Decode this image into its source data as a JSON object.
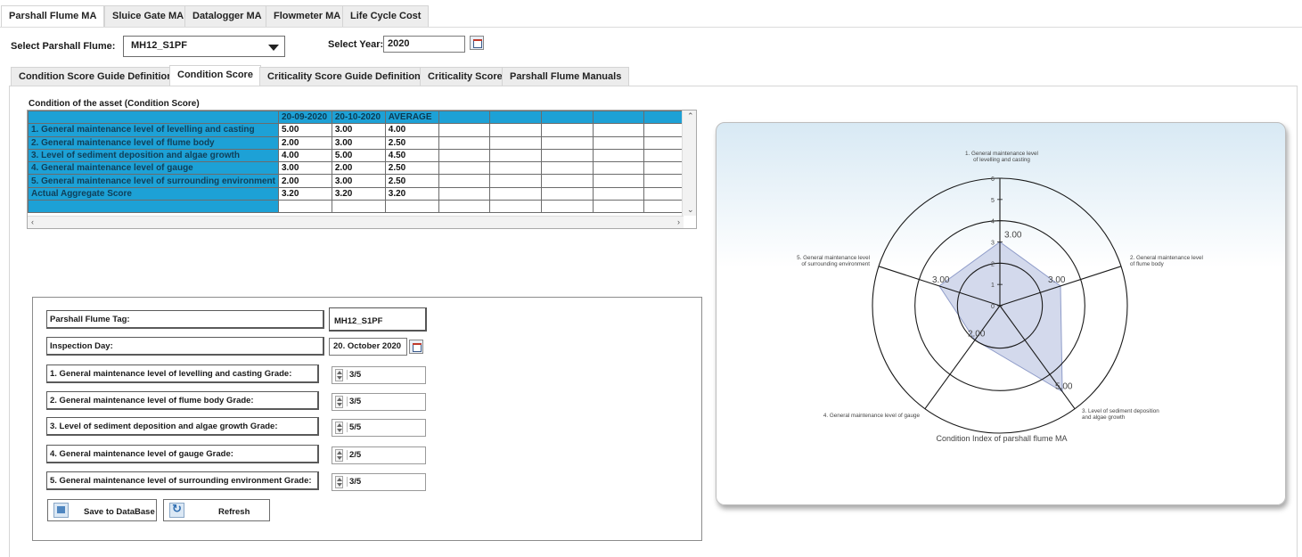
{
  "top_tabs": [
    "Parshall Flume MA",
    "Sluice Gate MA",
    "Datalogger MA",
    "Flowmeter MA",
    "Life Cycle Cost"
  ],
  "selector": {
    "flume_label": "Select Parshall Flume:",
    "flume_value": "MH12_S1PF",
    "year_label": "Select Year:",
    "year_value": "2020"
  },
  "sub_tabs": [
    "Condition Score Guide Definition",
    "Condition Score",
    "Criticality Score Guide Definition",
    "Criticality Score",
    "Parshall Flume Manuals"
  ],
  "grid": {
    "caption": "Condition of the asset (Condition Score)",
    "headers": [
      "20-09-2020",
      "20-10-2020",
      "AVERAGE"
    ],
    "rows": [
      {
        "label": "1. General maintenance level of levelling and casting",
        "v1": "5.00",
        "v2": "3.00",
        "avg": "4.00"
      },
      {
        "label": "2. General maintenance level of flume body",
        "v1": "2.00",
        "v2": "3.00",
        "avg": "2.50"
      },
      {
        "label": "3. Level of sediment deposition and algae growth",
        "v1": "4.00",
        "v2": "5.00",
        "avg": "4.50"
      },
      {
        "label": "4. General maintenance level of gauge",
        "v1": "3.00",
        "v2": "2.00",
        "avg": "2.50"
      },
      {
        "label": "5. General maintenance level of surrounding environment",
        "v1": "2.00",
        "v2": "3.00",
        "avg": "2.50"
      },
      {
        "label": "Actual Aggregate Score",
        "v1": "3.20",
        "v2": "3.20",
        "avg": "3.20"
      }
    ]
  },
  "form": {
    "tag_label": "Parshall Flume Tag:",
    "tag_value": "MH12_S1PF",
    "day_label": "Inspection Day:",
    "day_value": "20. October 2020",
    "grades": [
      {
        "label": "1. General maintenance level of levelling and casting Grade:",
        "value": "3/5"
      },
      {
        "label": "2. General maintenance level of flume body Grade:",
        "value": "3/5"
      },
      {
        "label": "3. Level of sediment deposition and algae growth Grade:",
        "value": "5/5"
      },
      {
        "label": "4. General maintenance level of gauge Grade:",
        "value": "2/5"
      },
      {
        "label": "5. General maintenance level of surrounding environment Grade:",
        "value": "3/5"
      }
    ],
    "save_label": "Save to DataBase",
    "refresh_label": "Refresh"
  },
  "icons": {
    "dropdown": "chevron-down-icon",
    "calendar": "calendar-icon",
    "save": "save-icon",
    "refresh": "refresh-icon"
  },
  "colors": {
    "grid_header": "#1da1d6",
    "radar_fill": "#c4cce6",
    "radar_stroke": "#8f9cc9"
  },
  "chart_data": {
    "type": "radar",
    "title": "Condition Index of parshall flume MA",
    "axes": [
      "1. General maintenance level of levelling and casting",
      "2. General maintenance level of flume body",
      "3. Level of sediment deposition and algae growth",
      "4. General maintenance level of gauge",
      "5. General maintenance level of surrounding environment"
    ],
    "axis_label_lines": [
      [
        "1. General maintenance level",
        "of levelling and casting"
      ],
      [
        "2. General maintenance level",
        "of flume body"
      ],
      [
        "3. Level of sediment deposition",
        "and algae growth"
      ],
      [
        "4. General maintenance level of gauge"
      ],
      [
        "5. General maintenance level",
        "of surrounding environment"
      ]
    ],
    "values": [
      3,
      3,
      5,
      2,
      3
    ],
    "data_labels": [
      "3.00",
      "3.00",
      "5.00",
      "2.00",
      "3.00"
    ],
    "ticks": [
      0,
      1,
      2,
      3,
      4,
      5,
      6
    ],
    "range": [
      0,
      6
    ]
  }
}
